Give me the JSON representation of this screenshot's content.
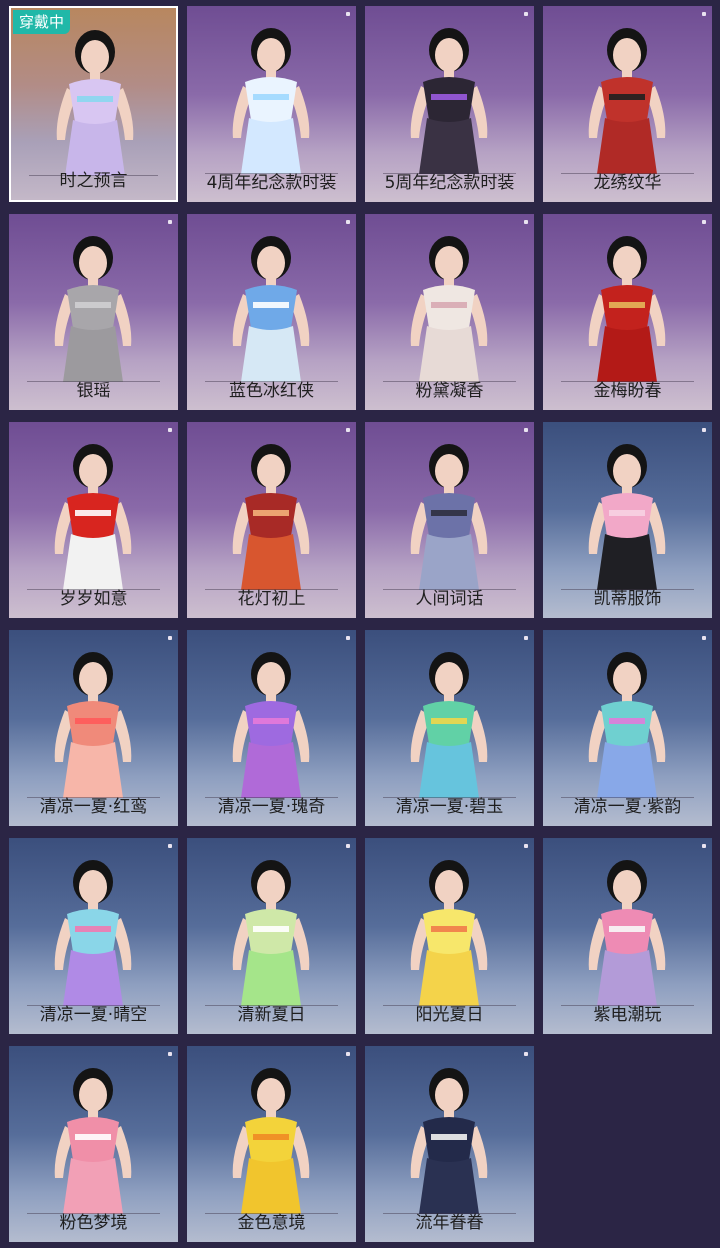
{
  "equipped_badge": "穿戴中",
  "colors": {
    "badge": "#20b8a8",
    "page_bg": "#2b2545"
  },
  "outfits": [
    {
      "name": "时之预言",
      "theme": "orange",
      "selected": true,
      "top": "#d8c6f2",
      "bottom": "#c8b6ea",
      "accent": "#8ad7f0"
    },
    {
      "name": "4周年纪念款时装",
      "theme": "purple",
      "top": "#eaf4ff",
      "bottom": "#d3e8ff",
      "accent": "#9fd8ff"
    },
    {
      "name": "5周年纪念款时装",
      "theme": "purple",
      "top": "#2c2634",
      "bottom": "#3a3244",
      "accent": "#9b5be0"
    },
    {
      "name": "龙绣纹华",
      "theme": "purple",
      "top": "#c0322b",
      "bottom": "#b02a26",
      "accent": "#1f1f1f"
    },
    {
      "name": "银瑶",
      "theme": "purple",
      "top": "#a8a6aa",
      "bottom": "#9c9a9e",
      "accent": "#cfcfd2"
    },
    {
      "name": "蓝色冰红侠",
      "theme": "purple",
      "top": "#6fa9e8",
      "bottom": "#d6e8f5",
      "accent": "#ffffff"
    },
    {
      "name": "粉黛凝香",
      "theme": "purple",
      "top": "#efe7e2",
      "bottom": "#e7dad6",
      "accent": "#d7a9b3"
    },
    {
      "name": "金梅盼春",
      "theme": "purple",
      "top": "#c3221d",
      "bottom": "#b31a17",
      "accent": "#e6b75a"
    },
    {
      "name": "岁岁如意",
      "theme": "purple",
      "top": "#d8251f",
      "bottom": "#f2f2f2",
      "accent": "#ffffff"
    },
    {
      "name": "花灯初上",
      "theme": "purple",
      "top": "#a82a26",
      "bottom": "#d8562f",
      "accent": "#f2b07a"
    },
    {
      "name": "人间词话",
      "theme": "purple",
      "top": "#6c72a8",
      "bottom": "#9aa4c8",
      "accent": "#2f2f3f"
    },
    {
      "name": "凯蒂服饰",
      "theme": "blue",
      "top": "#f2a8c8",
      "bottom": "#1f1f24",
      "accent": "#f7d2e2"
    },
    {
      "name": "清凉一夏·红鸾",
      "theme": "blue",
      "top": "#f08a7a",
      "bottom": "#f7b6a9",
      "accent": "#ff5a5a"
    },
    {
      "name": "清凉一夏·瑰奇",
      "theme": "blue",
      "top": "#9e6ae0",
      "bottom": "#b06ad8",
      "accent": "#e57ad9"
    },
    {
      "name": "清凉一夏·碧玉",
      "theme": "blue",
      "top": "#61d1a6",
      "bottom": "#66c4dd",
      "accent": "#f0d64a"
    },
    {
      "name": "清凉一夏·紫韵",
      "theme": "blue",
      "top": "#6fd0d0",
      "bottom": "#88a8e8",
      "accent": "#e07bd9"
    },
    {
      "name": "清凉一夏·晴空",
      "theme": "blue",
      "top": "#8ad6e8",
      "bottom": "#b08ae6",
      "accent": "#f07ab0"
    },
    {
      "name": "清新夏日",
      "theme": "blue",
      "top": "#cfe8a8",
      "bottom": "#a5e58a",
      "accent": "#ffffff"
    },
    {
      "name": "阳光夏日",
      "theme": "blue",
      "top": "#f7e76b",
      "bottom": "#f4d34a",
      "accent": "#f07b4a"
    },
    {
      "name": "紫电潮玩",
      "theme": "blue",
      "top": "#ee8bb4",
      "bottom": "#b39bd8",
      "accent": "#f7f7f7"
    },
    {
      "name": "粉色梦境",
      "theme": "blue",
      "top": "#f08fa8",
      "bottom": "#f2a0b6",
      "accent": "#ffffff"
    },
    {
      "name": "金色意境",
      "theme": "blue",
      "top": "#f3d33a",
      "bottom": "#f1c52d",
      "accent": "#f08a25"
    },
    {
      "name": "流年眷眷",
      "theme": "blue",
      "top": "#232a4a",
      "bottom": "#2a3152",
      "accent": "#f2f2f2"
    }
  ]
}
